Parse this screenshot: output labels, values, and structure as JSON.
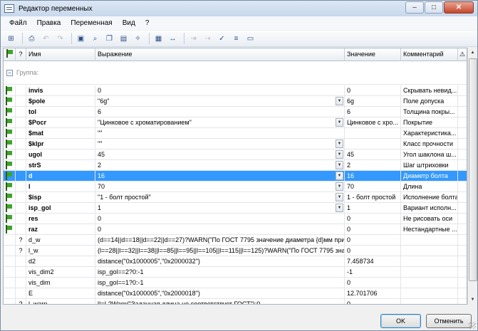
{
  "window": {
    "title": "Редактор переменных"
  },
  "menu": [
    "Файл",
    "Правка",
    "Переменная",
    "Вид",
    "?"
  ],
  "toolbar": {
    "icons": [
      "var-add-icon",
      "print-icon",
      "undo-icon",
      "redo-icon",
      "pe-icon",
      "binoculars-icon",
      "copy-icon",
      "paste-icon",
      "wizard-icon",
      "calc-icon",
      "dimension-icon",
      "move-right-icon",
      "move-right-alt-icon",
      "var-check-icon",
      "var-props-icon",
      "panel-icon"
    ]
  },
  "columns": {
    "flag": "",
    "q": "?",
    "name": "Имя",
    "expr": "Выражение",
    "value": "Значение",
    "comment": "Комментарий",
    "warn": "⚠"
  },
  "group": {
    "label": "Группа:",
    "toggle": "−"
  },
  "rows": [
    {
      "flag": true,
      "q": "",
      "name": "invis",
      "bold": true,
      "expr": "0",
      "dd": false,
      "value": "0",
      "comment": "Скрывать невид..."
    },
    {
      "flag": true,
      "q": "",
      "name": "$pole",
      "bold": true,
      "expr": "\"6g\"",
      "dd": true,
      "value": "6g",
      "comment": "Поле допуска"
    },
    {
      "flag": true,
      "q": "",
      "name": "tol",
      "bold": true,
      "expr": "6",
      "dd": false,
      "value": "6",
      "comment": "Толщина покры..."
    },
    {
      "flag": true,
      "q": "",
      "name": "$Pocr",
      "bold": true,
      "expr": "\"Цинковое с хроматированием\"",
      "dd": true,
      "value": "Цинковое с хро...",
      "comment": "Покрытие"
    },
    {
      "flag": true,
      "q": "",
      "name": "$mat",
      "bold": true,
      "expr": "\"\"",
      "dd": false,
      "value": "",
      "comment": "Характеристика..."
    },
    {
      "flag": true,
      "q": "",
      "name": "$klpr",
      "bold": true,
      "expr": "\"\"",
      "dd": true,
      "value": "",
      "comment": "Класс прочности"
    },
    {
      "flag": true,
      "q": "",
      "name": "ugol",
      "bold": true,
      "expr": "45",
      "dd": true,
      "value": "45",
      "comment": "Угол шаклона ш..."
    },
    {
      "flag": true,
      "q": "",
      "name": "strS",
      "bold": true,
      "expr": "2",
      "dd": true,
      "value": "2",
      "comment": "Шаг штриховки"
    },
    {
      "flag": true,
      "q": "",
      "name": "d",
      "bold": true,
      "expr": "16",
      "dd": true,
      "value": "16",
      "comment": "Диаметр болта",
      "selected": true
    },
    {
      "flag": true,
      "q": "",
      "name": "l",
      "bold": true,
      "expr": "70",
      "dd": true,
      "value": "70",
      "comment": "Длина"
    },
    {
      "flag": true,
      "q": "",
      "name": "$isp",
      "bold": true,
      "expr": "\"1 - болт простой\"",
      "dd": true,
      "value": "1 - болт простой",
      "comment": "Исполнение болта"
    },
    {
      "flag": true,
      "q": "",
      "name": "isp_gol",
      "bold": true,
      "expr": "1",
      "dd": true,
      "value": "1",
      "comment": "Вариант исполн..."
    },
    {
      "flag": true,
      "q": "",
      "name": "res",
      "bold": true,
      "expr": "0",
      "dd": false,
      "value": "0",
      "comment": "Не рисовать оси"
    },
    {
      "flag": true,
      "q": "",
      "name": "raz",
      "bold": true,
      "expr": "0",
      "dd": false,
      "value": "0",
      "comment": "Нестандартные ..."
    },
    {
      "flag": false,
      "q": "?",
      "name": "d_w",
      "bold": false,
      "expr": "(d==14||d==18||d==22||d==27)?WARN(\"По ГОСТ 7795 значение диаметра {d}мм прим...",
      "dd": false,
      "value": "0",
      "comment": ""
    },
    {
      "flag": false,
      "q": "?",
      "name": "l_w",
      "bold": false,
      "expr": "(l==28||l==32||l==38||l==85||l==95||l==105||l==115||l==125)?WARN(\"По ГОСТ 7795 значени...",
      "dd": false,
      "value": "0",
      "comment": ""
    },
    {
      "flag": false,
      "q": "",
      "name": "d2",
      "bold": false,
      "expr": "distance(\"0x1000005\",\"0x2000032\")",
      "dd": false,
      "value": "7.458734",
      "comment": ""
    },
    {
      "flag": false,
      "q": "",
      "name": "vis_dim2",
      "bold": false,
      "expr": "isp_gol==2?0:-1",
      "dd": false,
      "value": "-1",
      "comment": ""
    },
    {
      "flag": false,
      "q": "",
      "name": "vis_dim",
      "bold": false,
      "expr": "isp_gol==1?0:-1",
      "dd": false,
      "value": "0",
      "comment": ""
    },
    {
      "flag": false,
      "q": "",
      "name": "E",
      "bold": false,
      "expr": "distance(\"0x1000005\",\"0x2000018\")",
      "dd": false,
      "value": "12.701706",
      "comment": ""
    },
    {
      "flag": false,
      "q": "?",
      "name": "l_warn",
      "bold": false,
      "expr": "l!=L?Warn(\"Заданная длина не соответствует ГОСТ\"):0",
      "dd": false,
      "value": "0",
      "comment": ""
    }
  ],
  "buttons": {
    "ok": "OK",
    "cancel": "Отменить"
  },
  "colors": {
    "selection": "#3399ff",
    "flag": "#3fa42a"
  }
}
